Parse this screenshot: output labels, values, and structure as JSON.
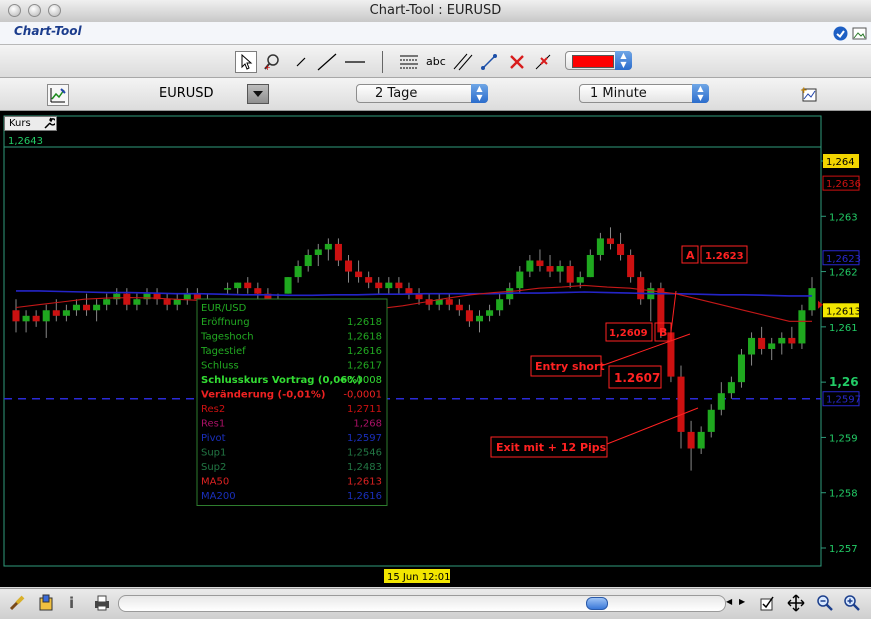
{
  "window": {
    "title": "Chart-Tool : EURUSD"
  },
  "app": {
    "name": "Chart-Tool"
  },
  "toolbar": {
    "text_tool_label": "abc",
    "color_value": "#ff0000"
  },
  "symbol_bar": {
    "symbol": "EURUSD",
    "period": "2 Tage",
    "interval": "1 Minute"
  },
  "panel": {
    "tab_label": "Kurs",
    "top_value": "1,2643"
  },
  "infobox": {
    "title": "EUR/USD",
    "rows": [
      {
        "label": "Eröffnung",
        "value": "1,2618",
        "color": "#22aa22"
      },
      {
        "label": "Tageshoch",
        "value": "1,2618",
        "color": "#22aa22"
      },
      {
        "label": "Tagestief",
        "value": "1,2616",
        "color": "#22aa22"
      },
      {
        "label": "Schluss",
        "value": "1,2617",
        "color": "#22aa22"
      },
      {
        "label": "Schlusskurs Vortrag (0,06%)",
        "value": "+0,0008",
        "color": "#33dd33"
      },
      {
        "label": "Veränderung (-0,01%)",
        "value": "-0,0001",
        "color": "#ee2222"
      },
      {
        "label": "Res2",
        "value": "1,2711",
        "color": "#cc1111"
      },
      {
        "label": "Res1",
        "value": "1,268",
        "color": "#aa1166"
      },
      {
        "label": "Pivot",
        "value": "1,2597",
        "color": "#1a2fbb"
      },
      {
        "label": "Sup1",
        "value": "1,2546",
        "color": "#227744"
      },
      {
        "label": "Sup2",
        "value": "1,2483",
        "color": "#227744"
      },
      {
        "label": "MA50",
        "value": "1,2613",
        "color": "#dd2222"
      },
      {
        "label": "MA200",
        "value": "1,2616",
        "color": "#1a2fbb"
      }
    ]
  },
  "annotations": {
    "label_a": "A",
    "value_a": "1.2623",
    "label_b": "B",
    "value_b": "1,2609",
    "entry_label": "Entry short",
    "entry_value": "1.2607",
    "exit_label": "Exit mit + 12 Pips"
  },
  "price_axis": {
    "ticks": [
      "1,264",
      "1,263",
      "1,262",
      "1,261",
      "1,26",
      "1,259",
      "1,258",
      "1,257"
    ],
    "marker_high": "1,2636",
    "marker_ma200": "1,2623",
    "marker_current": "1,2613",
    "marker_pivot": "1,2597"
  },
  "time_marker": "15 Jun 12:01",
  "colors": {
    "chart_border": "#2f9c7c",
    "bull_candle": "#1fa81f",
    "bear_candle": "#cc1111",
    "ma50": "#c41818",
    "ma200": "#2424c8",
    "pivot_line": "#2a2ad8",
    "annotation": "#ff2222",
    "axis_text": "#22cc66"
  },
  "chart_data": {
    "type": "candlestick",
    "ylim": [
      1.2565,
      1.2648
    ],
    "candles": [
      [
        1.2613,
        1.2615,
        1.2609,
        1.2611
      ],
      [
        1.2611,
        1.2613,
        1.2609,
        1.2612
      ],
      [
        1.2612,
        1.2613,
        1.261,
        1.2611
      ],
      [
        1.2611,
        1.2614,
        1.2608,
        1.2613
      ],
      [
        1.2613,
        1.2615,
        1.2611,
        1.2612
      ],
      [
        1.2612,
        1.2614,
        1.2611,
        1.2613
      ],
      [
        1.2613,
        1.2615,
        1.2612,
        1.2614
      ],
      [
        1.2614,
        1.2616,
        1.2612,
        1.2613
      ],
      [
        1.2613,
        1.2615,
        1.2611,
        1.2614
      ],
      [
        1.2614,
        1.2616,
        1.2613,
        1.2615
      ],
      [
        1.2615,
        1.2617,
        1.2614,
        1.2616
      ],
      [
        1.2616,
        1.2617,
        1.2613,
        1.2614
      ],
      [
        1.2614,
        1.2616,
        1.2613,
        1.2615
      ],
      [
        1.2615,
        1.2617,
        1.2614,
        1.2616
      ],
      [
        1.2616,
        1.2617,
        1.2614,
        1.2615
      ],
      [
        1.2615,
        1.2616,
        1.2613,
        1.2614
      ],
      [
        1.2614,
        1.2616,
        1.2613,
        1.2615
      ],
      [
        1.2615,
        1.2617,
        1.2614,
        1.2616
      ],
      [
        1.2616,
        1.2617,
        1.2614,
        1.2615
      ],
      [
        1.2615,
        1.2616,
        1.2612,
        1.2613
      ],
      [
        1.2613,
        1.2614,
        1.2608,
        1.2609
      ],
      [
        1.2617,
        1.2618,
        1.2616,
        1.2617
      ],
      [
        1.2617,
        1.2618,
        1.2616,
        1.2618
      ],
      [
        1.2618,
        1.2619,
        1.2616,
        1.2617
      ],
      [
        1.2617,
        1.2618,
        1.2615,
        1.2616
      ],
      [
        1.2616,
        1.2617,
        1.2614,
        1.2615
      ],
      [
        1.2615,
        1.2616,
        1.2613,
        1.2614
      ],
      [
        1.2616,
        1.2619,
        1.2616,
        1.2619
      ],
      [
        1.2619,
        1.2622,
        1.2618,
        1.2621
      ],
      [
        1.2621,
        1.2624,
        1.262,
        1.2623
      ],
      [
        1.2623,
        1.2625,
        1.2621,
        1.2624
      ],
      [
        1.2624,
        1.2626,
        1.2622,
        1.2625
      ],
      [
        1.2625,
        1.2626,
        1.2621,
        1.2622
      ],
      [
        1.2622,
        1.2623,
        1.2618,
        1.262
      ],
      [
        1.262,
        1.2622,
        1.2618,
        1.2619
      ],
      [
        1.2619,
        1.262,
        1.2617,
        1.2618
      ],
      [
        1.2618,
        1.2619,
        1.2616,
        1.2617
      ],
      [
        1.2617,
        1.2619,
        1.2616,
        1.2618
      ],
      [
        1.2618,
        1.2619,
        1.2616,
        1.2617
      ],
      [
        1.2617,
        1.2618,
        1.2615,
        1.2616
      ],
      [
        1.2616,
        1.2617,
        1.2614,
        1.2615
      ],
      [
        1.2615,
        1.2616,
        1.2613,
        1.2614
      ],
      [
        1.2614,
        1.2616,
        1.2613,
        1.2615
      ],
      [
        1.2615,
        1.2616,
        1.2613,
        1.2614
      ],
      [
        1.2614,
        1.2615,
        1.2612,
        1.2613
      ],
      [
        1.2613,
        1.2614,
        1.261,
        1.2611
      ],
      [
        1.2611,
        1.2613,
        1.2609,
        1.2612
      ],
      [
        1.2612,
        1.2614,
        1.2611,
        1.2613
      ],
      [
        1.2613,
        1.2616,
        1.2612,
        1.2615
      ],
      [
        1.2615,
        1.2618,
        1.2614,
        1.2617
      ],
      [
        1.2617,
        1.2621,
        1.2616,
        1.262
      ],
      [
        1.262,
        1.2623,
        1.2619,
        1.2622
      ],
      [
        1.2622,
        1.2624,
        1.262,
        1.2621
      ],
      [
        1.2621,
        1.2623,
        1.2619,
        1.262
      ],
      [
        1.262,
        1.2622,
        1.2618,
        1.2621
      ],
      [
        1.2621,
        1.2622,
        1.2617,
        1.2618
      ],
      [
        1.2618,
        1.262,
        1.2617,
        1.2619
      ],
      [
        1.2619,
        1.2624,
        1.2619,
        1.2623
      ],
      [
        1.2623,
        1.2627,
        1.2622,
        1.2626
      ],
      [
        1.2626,
        1.2628,
        1.2624,
        1.2625
      ],
      [
        1.2625,
        1.2627,
        1.2622,
        1.2623
      ],
      [
        1.2623,
        1.2624,
        1.2618,
        1.2619
      ],
      [
        1.2619,
        1.262,
        1.2614,
        1.2615
      ],
      [
        1.2615,
        1.2618,
        1.2611,
        1.2617
      ],
      [
        1.2617,
        1.2618,
        1.2608,
        1.2609
      ],
      [
        1.2609,
        1.261,
        1.26,
        1.2601
      ],
      [
        1.2601,
        1.2603,
        1.2588,
        1.2591
      ],
      [
        1.2591,
        1.2593,
        1.2584,
        1.2588
      ],
      [
        1.2588,
        1.2592,
        1.2587,
        1.2591
      ],
      [
        1.2591,
        1.2596,
        1.259,
        1.2595
      ],
      [
        1.2595,
        1.26,
        1.2594,
        1.2598
      ],
      [
        1.2598,
        1.2601,
        1.2597,
        1.26
      ],
      [
        1.26,
        1.2606,
        1.2599,
        1.2605
      ],
      [
        1.2605,
        1.2609,
        1.2603,
        1.2608
      ],
      [
        1.2608,
        1.261,
        1.2605,
        1.2606
      ],
      [
        1.2606,
        1.2608,
        1.2604,
        1.2607
      ],
      [
        1.2607,
        1.2609,
        1.2605,
        1.2608
      ],
      [
        1.2608,
        1.261,
        1.2606,
        1.2607
      ],
      [
        1.2607,
        1.2614,
        1.2606,
        1.2613
      ],
      [
        1.2613,
        1.2619,
        1.2612,
        1.2617
      ]
    ],
    "ma50": [
      1.26135,
      1.2614,
      1.26145,
      1.2615,
      1.26152,
      1.26153,
      1.26152,
      1.2615,
      1.26148,
      1.26145,
      1.26142,
      1.2614,
      1.26138,
      1.26135,
      1.2613,
      1.2613,
      1.26133,
      1.26138,
      1.26145,
      1.26152,
      1.26158,
      1.26162,
      1.26165,
      1.2617,
      1.26172,
      1.26175,
      1.26172,
      1.2617,
      1.26165,
      1.2616,
      1.2615,
      1.2614,
      1.2613,
      1.2612,
      1.2611,
      1.2611
    ],
    "ma200": [
      1.26165,
      1.26165,
      1.26164,
      1.26163,
      1.26162,
      1.26162,
      1.26161,
      1.2616,
      1.2616,
      1.26159,
      1.26158,
      1.26158,
      1.26157,
      1.26157,
      1.26158,
      1.26158,
      1.26159,
      1.26159,
      1.2616,
      1.2616,
      1.2616,
      1.2616,
      1.26161,
      1.26161,
      1.26162,
      1.26163,
      1.26162,
      1.26161,
      1.2616,
      1.2616,
      1.26159,
      1.26158,
      1.26158,
      1.26157,
      1.26156,
      1.26156
    ],
    "pivot": 1.2597,
    "top_line": 1.2643
  }
}
